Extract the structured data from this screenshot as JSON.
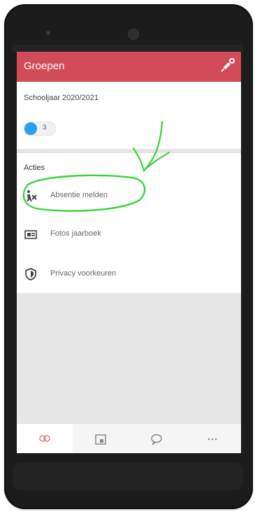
{
  "app": {
    "title": "Groepen",
    "header_action_icon": "pin-icon",
    "brand_color": "#d24b58"
  },
  "school_year": {
    "label": "Schooljaar 2020/2021",
    "toggle_count": "3",
    "toggle_color": "#2a9df4"
  },
  "actions": {
    "title": "Acties",
    "items": [
      {
        "label": "Absentie melden",
        "icon": "absence-icon"
      },
      {
        "label": "Fotos jaarboek",
        "icon": "yearbook-icon"
      },
      {
        "label": "Privacy voorkeuren",
        "icon": "shield-icon"
      }
    ]
  },
  "tabbar": {
    "items": [
      {
        "name": "groups",
        "icon": "groups-icon",
        "active": true
      },
      {
        "name": "calendar",
        "icon": "calendar-icon",
        "active": false
      },
      {
        "name": "chat",
        "icon": "chat-icon",
        "active": false
      },
      {
        "name": "more",
        "icon": "more-icon",
        "active": false
      }
    ]
  },
  "annotation": {
    "color": "#38d43a"
  }
}
